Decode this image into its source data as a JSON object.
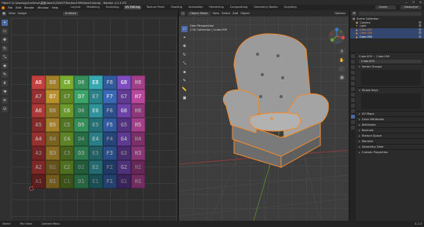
{
  "window": {
    "title": "*Item3 (C:\\Users\\g\\OneDrive\\桌面\\Item3\\204\\07\\Pavilion1999\\Item3.blend) - Blender 4.2.3 LTS",
    "controls": [
      "—",
      "☐",
      "✕"
    ]
  },
  "menubar": {
    "menus": [
      "File",
      "Edit",
      "Render",
      "Window",
      "Help"
    ],
    "workspaces": [
      "Layout",
      "Modeling",
      "Sculpting",
      "UV Editing",
      "Texture Paint",
      "Shading",
      "Animation",
      "Rendering",
      "Compositing",
      "Geometry Nodes",
      "Scripting"
    ],
    "active_workspace": "UV Editing",
    "scene_label": "Scene",
    "view_layer_label": "ViewLayer"
  },
  "uv_editor": {
    "header": [
      "View",
      "Image"
    ],
    "image_field": "Untitled",
    "tool_icons": [
      "cursor-icon",
      "select-box-icon",
      "grab-icon",
      "rotate-icon",
      "scale-icon",
      "transform-icon",
      "annotate-icon",
      "rip-icon",
      "grab-uv-icon",
      "relax-icon",
      "pinch-icon"
    ],
    "grid_rows": 8,
    "grid_cols": 8,
    "column_letters": [
      "A",
      "B",
      "C",
      "D",
      "E",
      "F",
      "G",
      "H"
    ],
    "row_numbers": [
      "8",
      "7",
      "6",
      "5",
      "4",
      "3",
      "2",
      "1"
    ],
    "column_colors": [
      "#c4403f",
      "#c59b32",
      "#7cad32",
      "#3fae6f",
      "#37a7b0",
      "#3d6fc0",
      "#7c4cc0",
      "#c44da6"
    ]
  },
  "viewport": {
    "header": [
      "Object Mode",
      "View",
      "Select",
      "Add",
      "Object"
    ],
    "mode": "Object Mode",
    "info_line1": "User Perspective",
    "info_line2": "(74) Collection | Cube.009",
    "options_label": "Options",
    "nav_icons": [
      "zoom-icon",
      "pan-icon",
      "camera-icon",
      "grid-icon"
    ],
    "gizmo_axes": [
      "X",
      "Y",
      "Z"
    ],
    "axis_colors": {
      "x": "#e0474c",
      "y": "#6ba634",
      "z": "#3a7ecf"
    }
  },
  "outliner": {
    "header_field": "Scene Collection",
    "rows": [
      {
        "label": "Scene Collection",
        "indent": 0,
        "selected": false
      },
      {
        "label": "Camera",
        "indent": 1,
        "selected": false
      },
      {
        "label": "Light",
        "indent": 1,
        "selected": false
      },
      {
        "label": "Cube.007",
        "indent": 1,
        "selected": true
      },
      {
        "label": "Cube.008",
        "indent": 1,
        "selected": true
      },
      {
        "label": "Cube.009",
        "indent": 1,
        "selected": true
      }
    ]
  },
  "properties": {
    "object_field": "Cube.009",
    "mesh_field": "Cube.009",
    "data_field": "Cube.009",
    "sections_open": [
      "Vertex Groups",
      "Shape Keys"
    ],
    "sections_closed": [
      "UV Maps",
      "Color Attributes",
      "Attributes",
      "Normals",
      "Texture Space",
      "Remesh",
      "Geometry Data",
      "Custom Properties"
    ],
    "tab_icons": [
      "tool-icon",
      "render-icon",
      "output-icon",
      "view-layer-icon",
      "scene-icon",
      "world-icon",
      "object-icon",
      "modifier-icon",
      "particles-icon",
      "physics-icon",
      "constraints-icon",
      "data-icon",
      "material-icon",
      "texture-icon"
    ]
  },
  "statusbar": {
    "left": "Select",
    "mid1": "Pan View",
    "mid2": "Context Menu",
    "version": "4.2.3"
  },
  "colors": {
    "accent": "#4b6aa3",
    "selection_orange": "#f08a2c",
    "blender_orange": "#e87d0d"
  }
}
